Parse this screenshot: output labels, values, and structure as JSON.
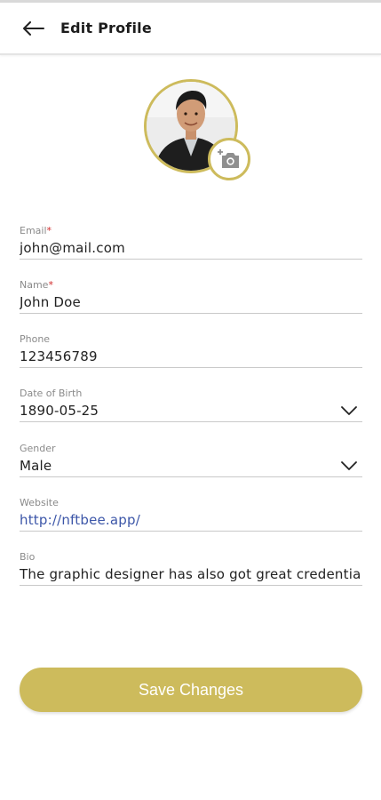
{
  "header": {
    "title": "Edit Profile"
  },
  "colors": {
    "accent": "#cdbb5c",
    "required": "#d12a2a",
    "link": "#3c56a8"
  },
  "icons": {
    "back": "arrow-left-icon",
    "camera": "add-camera-icon",
    "dropdown": "chevron-down-icon"
  },
  "form": {
    "email": {
      "label": "Email",
      "required_mark": "*",
      "value": "john@mail.com"
    },
    "name": {
      "label": "Name",
      "required_mark": "*",
      "value": "John Doe"
    },
    "phone": {
      "label": "Phone",
      "value": "123456789"
    },
    "dob": {
      "label": "Date of Birth",
      "value": "1890-05-25"
    },
    "gender": {
      "label": "Gender",
      "value": "Male"
    },
    "website": {
      "label": "Website",
      "value": "http://nftbee.app/"
    },
    "bio": {
      "label": "Bio",
      "value": "The graphic designer has also got great credentia"
    }
  },
  "actions": {
    "save_label": "Save Changes"
  }
}
